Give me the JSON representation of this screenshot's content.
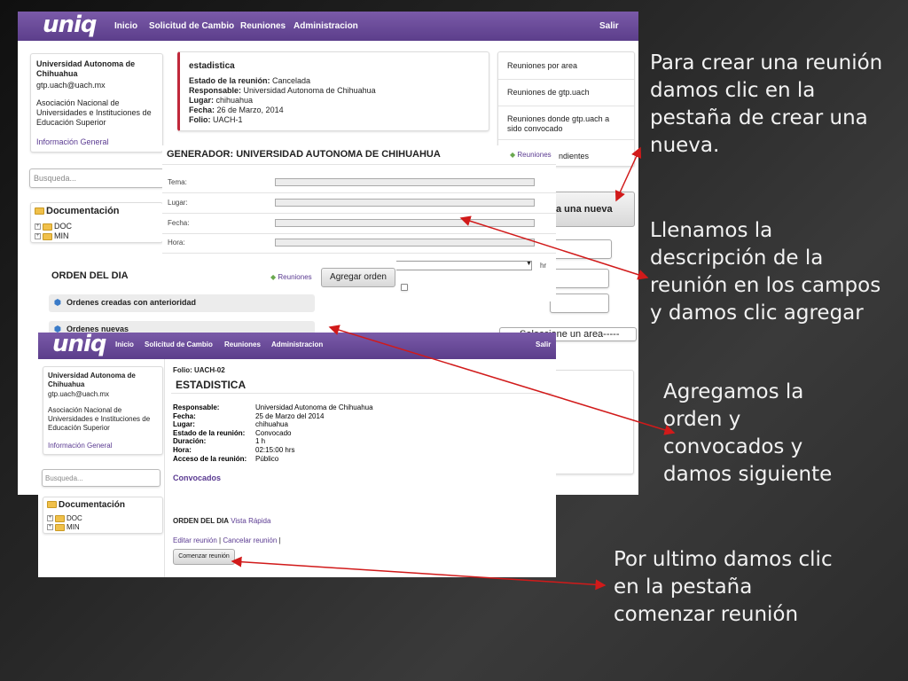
{
  "shot1": {
    "logo": "uniq",
    "nav": [
      "Inicio",
      "Solicitud de Cambio",
      "Reuniones",
      "Administracion"
    ],
    "salir": "Salir",
    "profile": {
      "university": "Universidad Autonoma de Chihuahua",
      "email": "gtp.uach@uach.mx",
      "association": "Asociación Nacional de Universidades e Instituciones de Educación Superior",
      "info_link": "Información General"
    },
    "search_placeholder": "Busqueda...",
    "documentation": {
      "title": "Documentación",
      "items": [
        "DOC",
        "MIN"
      ]
    },
    "meeting": {
      "title": "estadistica",
      "estado_label": "Estado de la reunión:",
      "estado_value": "Cancelada",
      "responsable_label": "Responsable:",
      "responsable_value": "Universidad Autonoma de Chihuahua",
      "lugar_label": "Lugar:",
      "lugar_value": "chihuahua",
      "fecha_label": "Fecha:",
      "fecha_value": "26 de Marzo, 2014",
      "folio_label": "Folio:",
      "folio_value": "UACH-1"
    },
    "right_menu": [
      "Reuniones por area",
      "Reuniones de gtp.uach",
      "Reuniones donde gtp.uach a sido convocado",
      "ndientes"
    ],
    "create_button_partial": "a una nueva",
    "select_partial": "Seleccione un area-----"
  },
  "generator": {
    "title": "GENERADOR: UNIVERSIDAD AUTONOMA DE CHIHUAHUA",
    "back_link": "Reuniones",
    "labels": [
      "Tema:",
      "Lugar:",
      "Fecha:",
      "Hora:"
    ],
    "hr_suffix": "hr"
  },
  "orden": {
    "title": "ORDEN DEL DIA",
    "back_link": "Reuniones",
    "add_button": "Agregar orden",
    "section_prev": "Ordenes creadas con anterioridad",
    "section_new": "Ordenes nuevas"
  },
  "shot2": {
    "logo": "uniq",
    "nav": [
      "Inicio",
      "Solicitud de Cambio",
      "Reuniones",
      "Administracion"
    ],
    "salir": "Salir",
    "profile": {
      "university": "Universidad Autonoma de Chihuahua",
      "email": "gtp.uach@uach.mx",
      "association": "Asociación Nacional de Universidades e Instituciones de Educación Superior",
      "info_link": "Información General"
    },
    "search_placeholder": "Busqueda...",
    "documentation": {
      "title": "Documentación",
      "items": [
        "DOC",
        "MIN"
      ]
    },
    "folio": "Folio: UACH-02",
    "title": "ESTADISTICA",
    "details": [
      {
        "label": "Responsable:",
        "value": "Universidad Autonoma de Chihuahua"
      },
      {
        "label": "Fecha:",
        "value": "25 de Marzo del 2014"
      },
      {
        "label": "Lugar:",
        "value": "chihuahua"
      },
      {
        "label": "Estado de la reunión:",
        "value": "Convocado"
      },
      {
        "label": "Duración:",
        "value": "1 h"
      },
      {
        "label": "Hora:",
        "value": "02:15:00 hrs"
      },
      {
        "label": "Acceso de la reunión:",
        "value": "Público"
      }
    ],
    "convocados": "Convocados",
    "orden_title": "ORDEN DEL DIA",
    "vista_rapida": "Vista Rápida",
    "edit_link": "Editar reunión",
    "cancel_link": "Cancelar reunión",
    "link_sep": "|",
    "start_button": "Comenzar reunión"
  },
  "captions": {
    "c1": [
      "Para crear una reunión",
      "damos clic en la",
      "pestaña de crear una",
      "nueva."
    ],
    "c2": [
      "Llenamos la",
      "descripción de la",
      "reunión en los campos",
      "y damos clic agregar"
    ],
    "c3": [
      "Agregamos la",
      "orden y",
      "convocados y",
      "damos siguiente"
    ],
    "c4": [
      "Por ultimo damos clic",
      "en la pestaña",
      "comenzar reunión"
    ]
  },
  "colors": {
    "accent": "#5c3e8b",
    "arrow": "#d11a1a",
    "meeting_border": "#c0283a"
  }
}
